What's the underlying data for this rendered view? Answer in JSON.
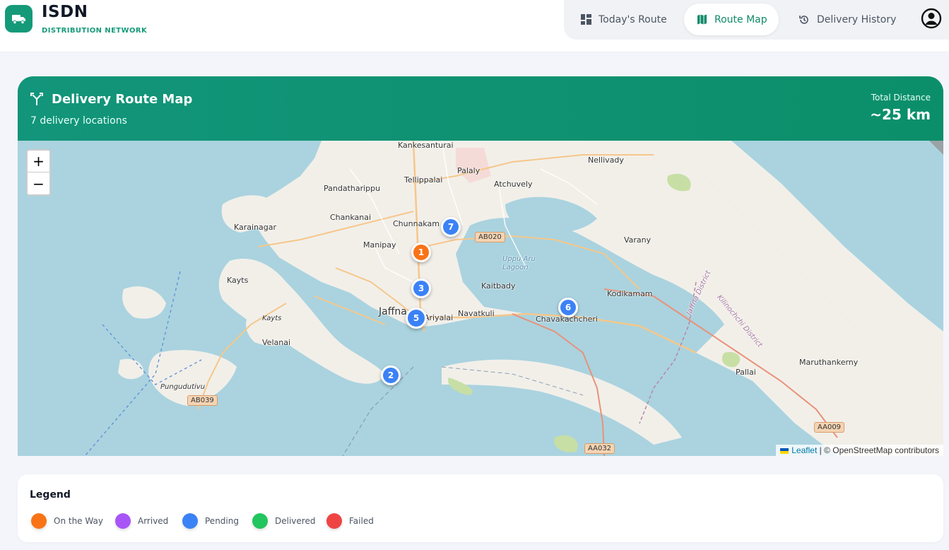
{
  "brand": {
    "title": "ISDN",
    "subtitle": "DISTRIBUTION NETWORK",
    "logo_icon": "truck-icon"
  },
  "nav": {
    "items": [
      {
        "label": "Today's Route",
        "icon": "grid-icon",
        "active": false
      },
      {
        "label": "Route Map",
        "icon": "map-icon",
        "active": true
      },
      {
        "label": "Delivery History",
        "icon": "history-icon",
        "active": false
      }
    ],
    "user_icon": "user-circle-icon"
  },
  "card": {
    "title": "Delivery Route Map",
    "title_icon": "route-fork-icon",
    "subtitle": "7 delivery locations",
    "distance_label": "Total Distance",
    "distance_value": "~25 km"
  },
  "map": {
    "zoom_in": "+",
    "zoom_out": "−",
    "places": [
      "Kankesanturai",
      "Palaly",
      "Nellivady",
      "Tellippalai",
      "Pandatharippu",
      "Atchuvely",
      "Chankanai",
      "Chunnakam",
      "Karainagar",
      "Manipay",
      "Varany",
      "Kaitbady",
      "Kodikamam",
      "Kayts",
      "Jaffna",
      "Ariyalai",
      "Navatkuli",
      "Chavakachcheri",
      "Kayts",
      "Velanai",
      "Pungudutivu",
      "Pallai",
      "Maruthankerny",
      "Uppu Aru Lagoon",
      "Jaffna District",
      "Kilinochchi District"
    ],
    "road_labels": [
      "AB020",
      "AB039",
      "AA009",
      "AA032"
    ],
    "markers": [
      {
        "label": "1",
        "status": "on_the_way"
      },
      {
        "label": "2",
        "status": "pending"
      },
      {
        "label": "3",
        "status": "pending"
      },
      {
        "label": "5",
        "status": "pending"
      },
      {
        "label": "6",
        "status": "pending"
      },
      {
        "label": "7",
        "status": "pending"
      }
    ],
    "attribution": {
      "leaflet": "Leaflet",
      "separator": " | © ",
      "osm": "OpenStreetMap contributors"
    }
  },
  "legend": {
    "title": "Legend",
    "items": [
      {
        "label": "On the Way",
        "color": "#f97316"
      },
      {
        "label": "Arrived",
        "color": "#a855f7"
      },
      {
        "label": "Pending",
        "color": "#3b82f6"
      },
      {
        "label": "Delivered",
        "color": "#22c55e"
      },
      {
        "label": "Failed",
        "color": "#ef4444"
      }
    ]
  },
  "colors": {
    "accent": "#159a79",
    "on_the_way": "#f97316",
    "pending": "#3b82f6"
  }
}
